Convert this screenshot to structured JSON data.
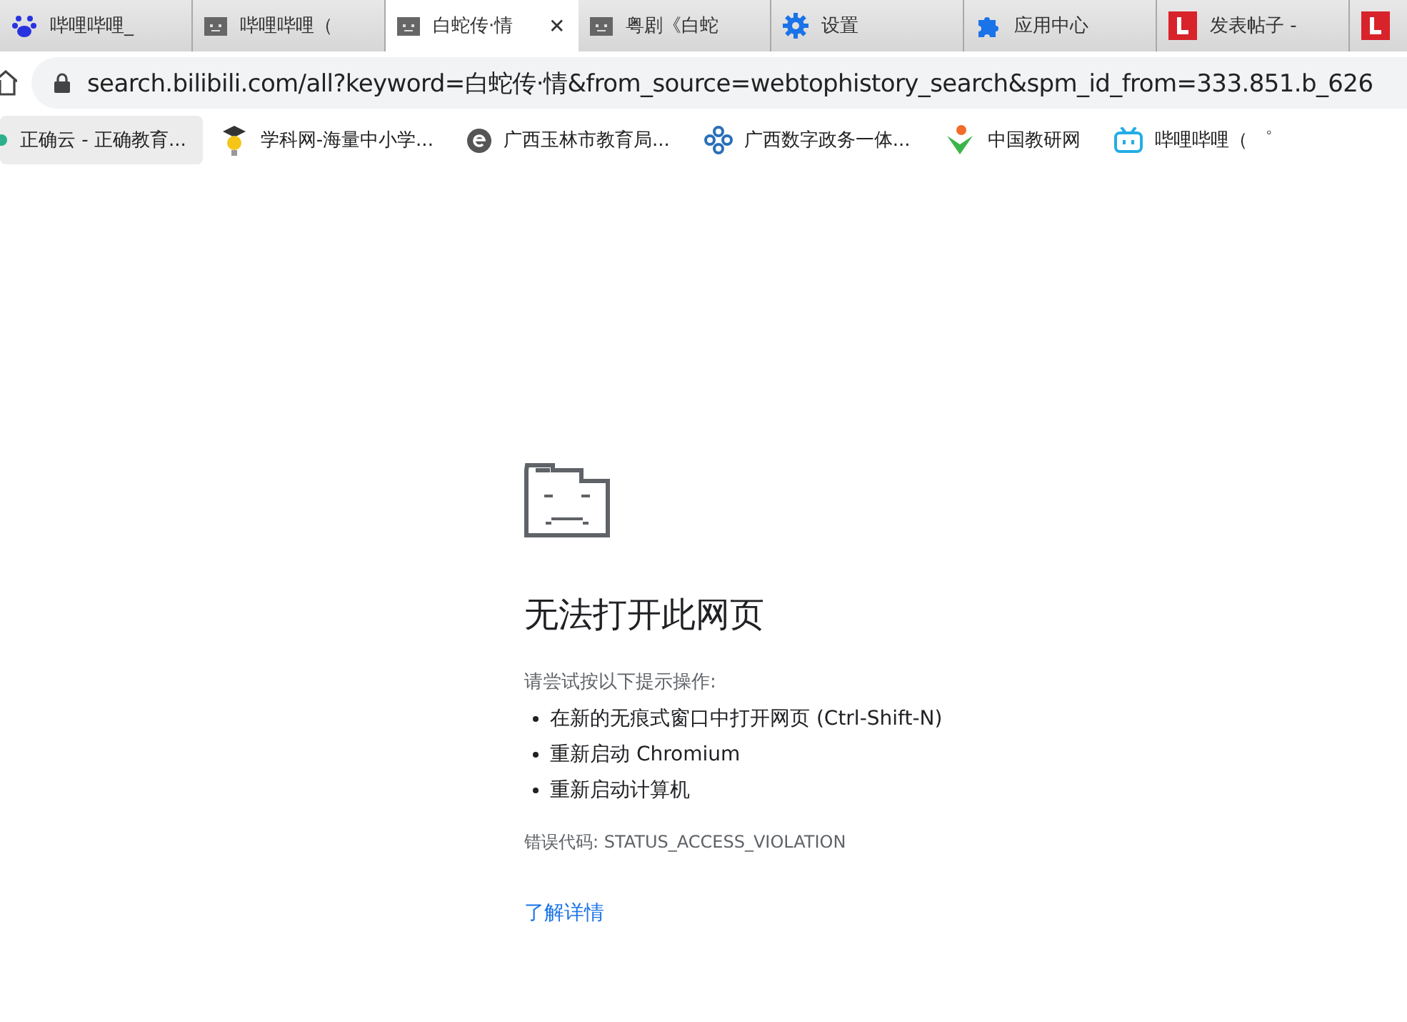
{
  "tabs": [
    {
      "kind": "paw",
      "title": "哔哩哔哩_",
      "selected": false
    },
    {
      "kind": "sad-folder",
      "title": "哔哩哔哩（",
      "selected": false
    },
    {
      "kind": "sad-folder",
      "title": "白蛇传·情",
      "selected": true,
      "close": "✕"
    },
    {
      "kind": "sad-folder",
      "title": "粤剧《白蛇",
      "selected": false
    },
    {
      "kind": "gear",
      "title": "设置",
      "selected": false
    },
    {
      "kind": "puzzle",
      "title": "应用中心",
      "selected": false
    },
    {
      "kind": "letter-l",
      "title": "发表帖子 -",
      "selected": false
    },
    {
      "kind": "letter-l",
      "selected": false
    }
  ],
  "address_bar": {
    "url": "search.bilibili.com/all?keyword=白蛇传·情&from_source=webtophistory_search&spm_id_from=333.851.b_626"
  },
  "bookmarks": [
    {
      "kind": "dot",
      "title": "正确云 - 正确教育...",
      "selected": true
    },
    {
      "kind": "scholar",
      "title": "学科网-海量中小学...",
      "selected": false
    },
    {
      "kind": "e-circle",
      "title": "广西玉林市教育局...",
      "selected": false
    },
    {
      "kind": "knot",
      "title": "广西数字政务一体...",
      "selected": false
    },
    {
      "kind": "figure",
      "title": "中国教研网",
      "selected": false
    },
    {
      "kind": "tv",
      "title": "哔哩哔哩（ ゜",
      "selected": false
    }
  ],
  "error": {
    "title": "无法打开此网页",
    "hint": "请尝试按以下提示操作:",
    "suggestions": [
      "在新的无痕式窗口中打开网页 (Ctrl-Shift-N)",
      "重新启动 Chromium",
      "重新启动计算机"
    ],
    "code": "错误代码: STATUS_ACCESS_VIOLATION",
    "link": "了解详情"
  }
}
